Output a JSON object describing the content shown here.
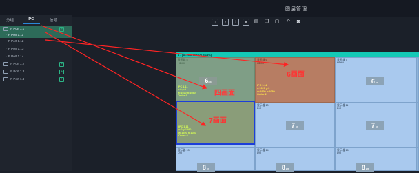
{
  "app": {
    "title": "图层管理"
  },
  "tabs": [
    {
      "label": "分组",
      "active": false
    },
    {
      "label": "IPC",
      "active": true
    },
    {
      "label": "信号",
      "active": false
    }
  ],
  "tree": [
    {
      "label": "IP Port 1.1",
      "group": true,
      "selected": true
    },
    {
      "label": "- IP Port 1.11",
      "group": false,
      "selected": true
    },
    {
      "label": "- IP Port 1.12",
      "group": false,
      "selected": false
    },
    {
      "label": "- IP Port 1.13",
      "group": false,
      "selected": false
    },
    {
      "label": "- IP Port 1.14",
      "group": false,
      "selected": false
    },
    {
      "label": "IP Port 1.2",
      "group": true,
      "selected": false
    },
    {
      "label": "IP Port 1.3",
      "group": true,
      "selected": false
    },
    {
      "label": "IP Port 1.4",
      "group": true,
      "selected": false
    }
  ],
  "toolbar": {
    "icons": [
      "download-icon",
      "upload-icon",
      "move-up-icon",
      "close-icon",
      "layers-icon",
      "copy-icon",
      "paste-icon",
      "undo-icon",
      "stop-icon"
    ]
  },
  "canvas": {
    "header": "1 - (W:7680 H:4320 5.14%)",
    "cells": [
      {
        "name": "显示器 5",
        "sub": "HDMI",
        "index": "6",
        "small": "2/3"
      },
      {
        "name": "显示器 6",
        "sub": "HDMI",
        "index": "",
        "small": ""
      },
      {
        "name": "显示器 7",
        "sub": "HDMI",
        "index": "6",
        "small": "2/3"
      },
      {
        "name": "显示器 9",
        "sub": "DVI",
        "index": "",
        "small": ""
      },
      {
        "name": "显示器 10",
        "sub": "DVI",
        "index": "7",
        "small": "2/3"
      },
      {
        "name": "显示器 11",
        "sub": "DVI",
        "index": "7",
        "small": "2/3"
      },
      {
        "name": "显示器 13",
        "sub": "DVI",
        "index": "8",
        "small": "2/3"
      },
      {
        "name": "显示器 14",
        "sub": "DVI",
        "index": "8",
        "small": "2/3"
      },
      {
        "name": "显示器 15",
        "sub": "DVI",
        "index": "8",
        "small": "2/3"
      }
    ],
    "overlays": [
      {
        "label": "四画面",
        "info": [
          "IPC 1.11",
          "x:0  y:0",
          "w:1920  h:1080",
          "Order:1"
        ]
      },
      {
        "label": "6画面",
        "info": [
          "IPC 1.12",
          "x:1920  y:0",
          "w:1920  h:1080",
          "Order:2"
        ]
      },
      {
        "label": "7画面",
        "info": [
          "IPC 1.11",
          "x:0  y:1080",
          "w:1920  h:1080",
          "Order:3"
        ]
      }
    ]
  }
}
